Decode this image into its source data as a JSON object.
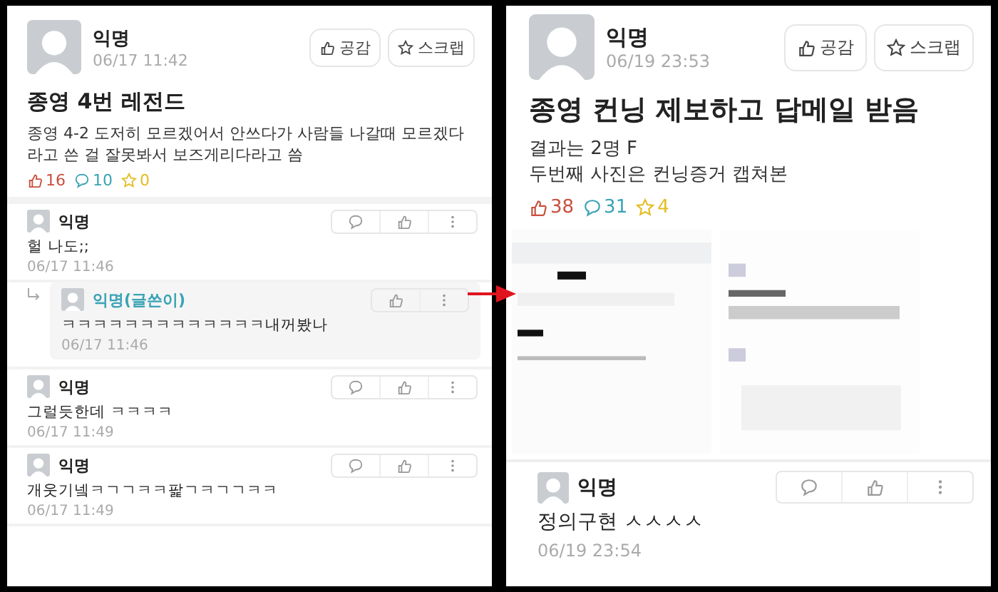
{
  "panels": [
    {
      "post": {
        "author": "익명",
        "time": "06/17 11:42",
        "like_button": "공감",
        "scrap_button": "스크랩",
        "title": "종영 4번 레전드",
        "body": [
          "종영 4-2 도저히 모르겠어서 안쓰다가 사람들 나갈때  모르겠다 라고 쓴 걸 잘못봐서 보즈게리다라고 씀"
        ],
        "likes": "16",
        "comments": "10",
        "scraps": "0"
      },
      "comments": [
        {
          "kind": "comment",
          "author": "익명",
          "text": "헐 나도;;",
          "time": "06/17 11:46"
        },
        {
          "kind": "reply",
          "author": "익명(글쓴이)",
          "text": "ㅋㅋㅋㅋㅋㅋㅋㅋㅋㅋㅋㅋㅋ내꺼봤나",
          "time": "06/17 11:46"
        },
        {
          "kind": "comment",
          "author": "익명",
          "text": "그럴듯한데 ㅋㅋㅋㅋ",
          "time": "06/17 11:49"
        },
        {
          "kind": "comment",
          "author": "익명",
          "text": "개웃기넼ㅋㄱㄱㅋㅋ팙ㄱㅋㄱㄱㅋㅋ",
          "time": "06/17 11:49"
        }
      ]
    },
    {
      "post": {
        "author": "익명",
        "time": "06/19 23:53",
        "like_button": "공감",
        "scrap_button": "스크랩",
        "title": "종영 컨닝 제보하고 답메일 받음",
        "body": [
          "결과는 2명 F",
          "두번째 사진은 컨닝증거 캡쳐본"
        ],
        "likes": "38",
        "comments": "31",
        "scraps": "4"
      },
      "comments": [
        {
          "kind": "comment",
          "author": "익명",
          "text": "정의구현 ㅅㅅㅅㅅ",
          "time": "06/19 23:54"
        }
      ]
    }
  ]
}
